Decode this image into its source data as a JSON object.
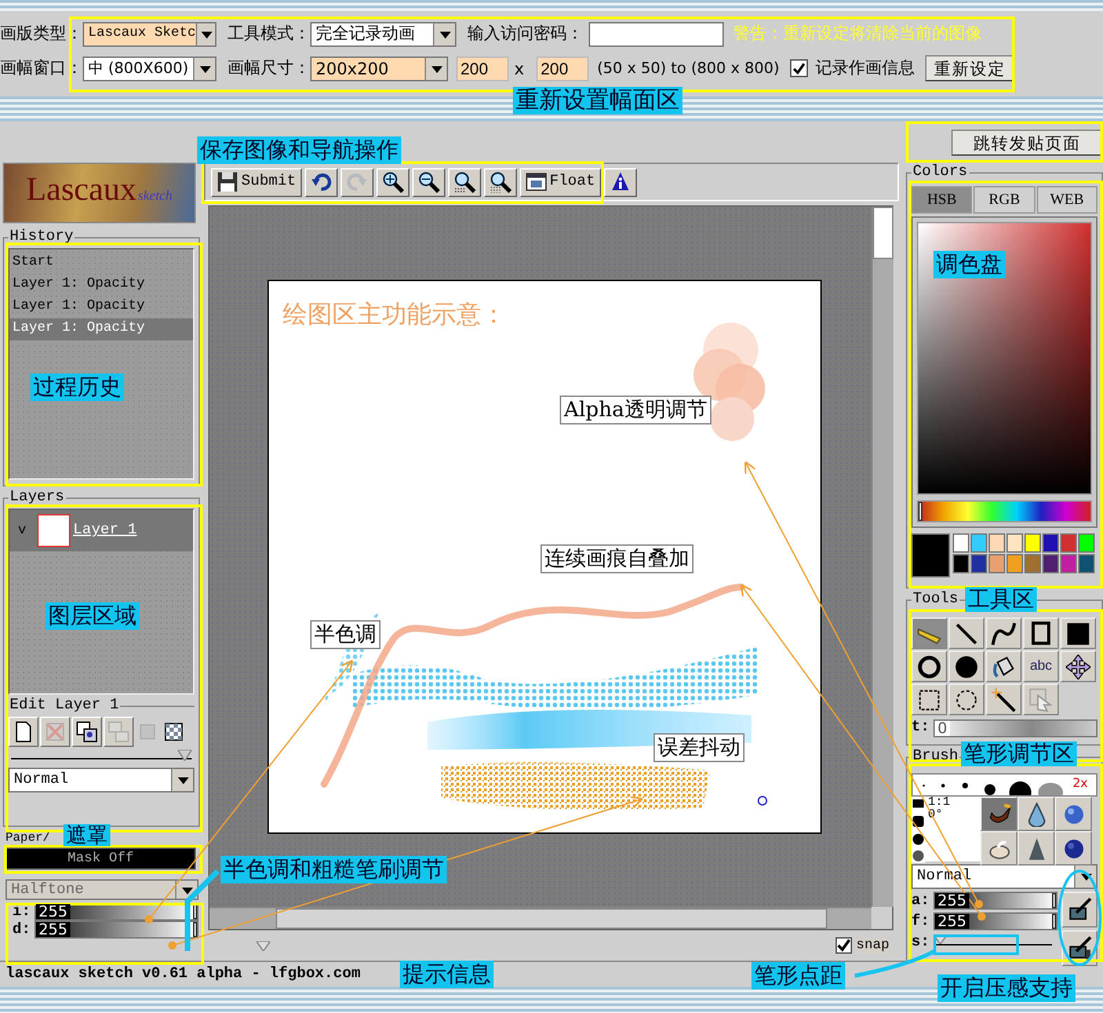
{
  "settings": {
    "annotation": "重新设置幅面区",
    "canvas_type": {
      "label": "画版类型：",
      "value": "Lascaux Sketc",
      "highlighted": true
    },
    "tool_mode": {
      "label": "工具模式：",
      "value": "完全记录动画",
      "highlighted": false
    },
    "password": {
      "label": "输入访问密码："
    },
    "warning": "警告：重新设定将清除当前的图像",
    "window_size": {
      "label": "画幅窗口：",
      "value": "中 (800X600)",
      "highlighted": false
    },
    "canvas_size": {
      "label": "画幅尺寸：",
      "value": "200x200",
      "highlighted": true
    },
    "width": {
      "value": "200",
      "highlighted": true
    },
    "separator": "x",
    "height": {
      "value": "200",
      "highlighted": true
    },
    "range": "(50 x 50) to (800 x 800)",
    "record": {
      "label": "记录作画信息",
      "checked": true
    },
    "reset_button": "重新设定"
  },
  "logo": {
    "title": "Lascaux",
    "subtitle": "sketch"
  },
  "history": {
    "title": "History",
    "annotation": "过程历史",
    "items": [
      {
        "label": "Start",
        "selected": false
      },
      {
        "label": "Layer 1: Opacity",
        "selected": false
      },
      {
        "label": "Layer 1: Opacity",
        "selected": false
      },
      {
        "label": "Layer 1: Opacity",
        "selected": true
      }
    ]
  },
  "layers": {
    "title": "Layers",
    "annotation": "图层区域",
    "items": [
      {
        "name": "Layer 1",
        "visibility": "v",
        "selected": true
      }
    ]
  },
  "edit_layer": {
    "title": "Edit Layer 1",
    "tools": [
      {
        "kind": "new",
        "disabled": false
      },
      {
        "kind": "delete",
        "disabled": true
      },
      {
        "kind": "duplicate",
        "disabled": false
      },
      {
        "kind": "merge",
        "disabled": true
      },
      {
        "kind": "solid",
        "disabled": true
      },
      {
        "kind": "transparent",
        "disabled": false
      }
    ],
    "opacity": {
      "level": 1
    },
    "blend_mode": "Normal"
  },
  "paper": {
    "title": "Paper/",
    "annotation": "遮罩",
    "mask_button": "Mask Off",
    "halftone": {
      "value": "Halftone",
      "disabled": true
    },
    "brush_annotation": "半色调和粗糙笔刷调节",
    "sliders": [
      {
        "label": "i:",
        "reading": "255",
        "level": 1
      },
      {
        "label": "d:",
        "reading": "255",
        "level": 1
      }
    ]
  },
  "toolbar": {
    "annotation": "保存图像和导航操作",
    "buttons": [
      {
        "kind": "submit",
        "label": "Submit",
        "disabled": false
      },
      {
        "kind": "undo",
        "disabled": false
      },
      {
        "kind": "redo",
        "disabled": true
      },
      {
        "kind": "zoom-in",
        "disabled": false
      },
      {
        "kind": "zoom-out",
        "disabled": false
      },
      {
        "kind": "zoom-grid",
        "disabled": false
      },
      {
        "kind": "zoom-dots",
        "disabled": false
      },
      {
        "kind": "float",
        "label": "Float",
        "disabled": false
      },
      {
        "kind": "info",
        "disabled": false
      }
    ]
  },
  "canvas": {
    "heading": "绘图区主功能示意：",
    "callouts": [
      {
        "kind": "alpha",
        "text": "Alpha透明调节"
      },
      {
        "kind": "overlap",
        "text": "连续画痕自叠加"
      },
      {
        "kind": "halftone",
        "text": "半色调"
      },
      {
        "kind": "dither",
        "text": "误差抖动"
      }
    ]
  },
  "snap": {
    "label": "snap",
    "checked": true
  },
  "status_bar": {
    "text": "lascaux sketch v0.61 alpha - lfgbox.com",
    "annotation": "提示信息"
  },
  "jump_button": "跳转发贴页面",
  "colors": {
    "title": "Colors",
    "annotation": "调色盘",
    "tabs": [
      {
        "label": "HSB",
        "selected": true
      },
      {
        "label": "RGB",
        "selected": false
      },
      {
        "label": "WEB",
        "selected": false
      }
    ],
    "hue": {
      "level": 0
    },
    "current": {
      "color": "#000000"
    },
    "swatches": [
      {
        "color": "#ffffff"
      },
      {
        "color": "#33ccff"
      },
      {
        "color": "#ffd9b3"
      },
      {
        "color": "#ffe4c0"
      },
      {
        "color": "#ffff00"
      },
      {
        "color": "#2010b0"
      },
      {
        "color": "#d03030"
      },
      {
        "color": "#00ff00"
      },
      {
        "color": "#000000"
      },
      {
        "color": "#2030a0"
      },
      {
        "color": "#e8a070"
      },
      {
        "color": "#f0a020"
      },
      {
        "color": "#a07030"
      },
      {
        "color": "#502070"
      },
      {
        "color": "#c020a0"
      },
      {
        "color": "#105070"
      }
    ]
  },
  "tools": {
    "title": "Tools",
    "annotation": "工具区",
    "items": [
      {
        "kind": "pencil",
        "selected": true
      },
      {
        "kind": "line",
        "selected": false
      },
      {
        "kind": "curve",
        "selected": false
      },
      {
        "kind": "rect",
        "selected": false
      },
      {
        "kind": "rect-fill",
        "selected": false
      },
      {
        "kind": "ellipse",
        "selected": false
      },
      {
        "kind": "ellipse-fill",
        "selected": false
      },
      {
        "kind": "bucket",
        "selected": false
      },
      {
        "kind": "text",
        "label": "abc",
        "selected": false
      },
      {
        "kind": "move",
        "selected": false
      },
      {
        "kind": "select-rect",
        "selected": false
      },
      {
        "kind": "select-ellipse",
        "selected": false
      },
      {
        "kind": "wand",
        "selected": false
      },
      {
        "kind": "copy",
        "selected": false
      }
    ],
    "t_label": "t:",
    "t_reading": "0",
    "t_slider": {
      "level": 0
    }
  },
  "brush": {
    "title": "Brush",
    "annotation": "笔形调节区",
    "size_badge": "2x",
    "ratio": "1:1",
    "angle": "0°",
    "types": [
      {
        "kind": "brush",
        "selected": true
      },
      {
        "kind": "droplet",
        "selected": false
      },
      {
        "kind": "sphere",
        "selected": false
      },
      {
        "kind": "eraser",
        "selected": false
      },
      {
        "kind": "cone",
        "selected": false
      },
      {
        "kind": "sphere-dark",
        "selected": false
      }
    ],
    "mode": "Normal",
    "sliders": [
      {
        "label": "a:",
        "reading": "255",
        "level": 1
      },
      {
        "label": "f:",
        "reading": "255",
        "level": 1
      }
    ],
    "spacing": {
      "label": "s:",
      "level": 0,
      "annotation": "笔形点距"
    },
    "pressure": [
      {
        "kind": "alpha"
      },
      {
        "kind": "size"
      }
    ],
    "pressure_annotation": "开启压感支持"
  }
}
